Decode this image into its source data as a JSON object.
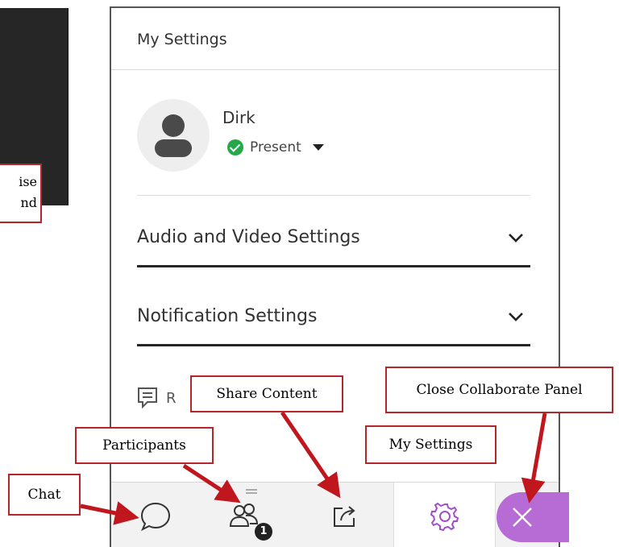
{
  "background_callout": {
    "line1": "ise",
    "line2": "nd"
  },
  "panel": {
    "title": "My Settings",
    "user": {
      "name": "Dirk",
      "status": "Present"
    },
    "sections": [
      {
        "label": "Audio and Video Settings"
      },
      {
        "label": "Notification Settings"
      }
    ],
    "report_label": "R"
  },
  "toolbar": {
    "participants_badge": "1"
  },
  "callouts": {
    "share": "Share Content",
    "close": "Close Collaborate Panel",
    "participants": "Participants",
    "my_settings": "My Settings",
    "chat": "Chat"
  },
  "colors": {
    "accent_purple": "#b76bd4",
    "settings_icon": "#a24fc7",
    "present_green": "#26a84a",
    "callout_border": "#b3262c",
    "arrow_red": "#c0161d"
  }
}
